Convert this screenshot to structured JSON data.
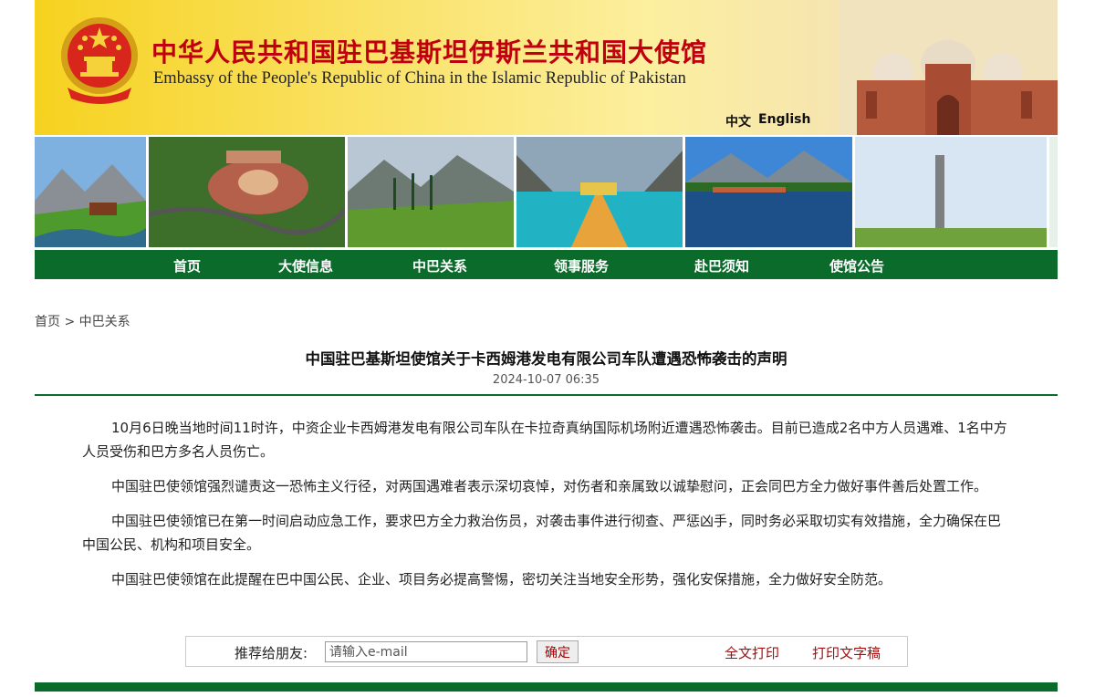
{
  "header": {
    "title_cn": "中华人民共和国驻巴基斯坦伊斯兰共和国大使馆",
    "title_en": "Embassy of the People's Republic of China in the Islamic Republic of Pakistan",
    "lang_cn": "中文",
    "lang_en": "English"
  },
  "nav": [
    "首页",
    "大使信息",
    "中巴关系",
    "领事服务",
    "赴巴须知",
    "使馆公告"
  ],
  "breadcrumb": {
    "home": "首页",
    "sep": ">",
    "current": "中巴关系"
  },
  "article": {
    "title": "中国驻巴基斯坦使馆关于卡西姆港发电有限公司车队遭遇恐怖袭击的声明",
    "date": "2024-10-07 06:35",
    "paragraphs": [
      "10月6日晚当地时间11时许，中资企业卡西姆港发电有限公司车队在卡拉奇真纳国际机场附近遭遇恐怖袭击。目前已造成2名中方人员遇难、1名中方人员受伤和巴方多名人员伤亡。",
      "中国驻巴使领馆强烈谴责这一恐怖主义行径，对两国遇难者表示深切哀悼，对伤者和亲属致以诚挚慰问，正会同巴方全力做好事件善后处置工作。",
      "中国驻巴使领馆已在第一时间启动应急工作，要求巴方全力救治伤员，对袭击事件进行彻查、严惩凶手，同时务必采取切实有效措施，全力确保在巴中国公民、机构和项目安全。",
      "中国驻巴使领馆在此提醒在巴中国公民、企业、项目务必提高警惕，密切关注当地安全形势，强化安保措施，全力做好安全防范。"
    ]
  },
  "share": {
    "label": "推荐给朋友:",
    "placeholder": "请输入e-mail",
    "confirm": "确定",
    "print_full": "全文打印",
    "print_text": "打印文字稿"
  },
  "colors": {
    "nav_green": "#0a6b2b",
    "title_red": "#c0000f",
    "banner_yellow": "#f6d21f"
  }
}
